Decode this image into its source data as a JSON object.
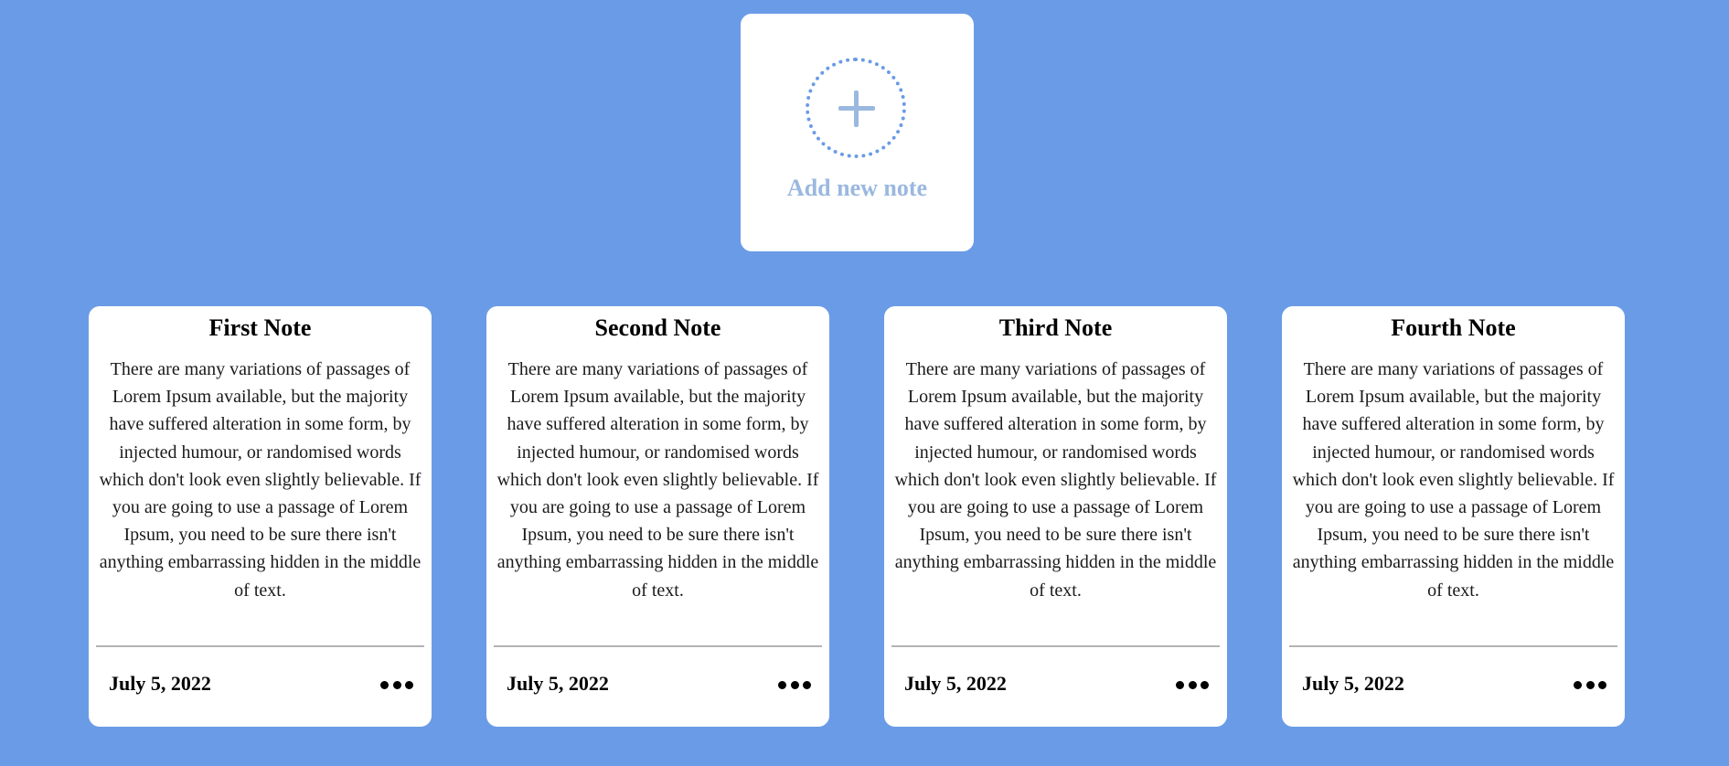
{
  "add_card": {
    "label": "Add new note",
    "icon": "plus-icon"
  },
  "notes": [
    {
      "title": "First Note",
      "body": "There are many variations of passages of Lorem Ipsum available, but the majority have suffered alteration in some form, by injected humour, or randomised words which don't look even slightly believable. If you are going to use a passage of Lorem Ipsum, you need to be sure there isn't anything embarrassing hidden in the middle of text.",
      "date": "July 5, 2022",
      "menu_icon": "more-horizontal-icon"
    },
    {
      "title": "Second Note",
      "body": "There are many variations of passages of Lorem Ipsum available, but the majority have suffered alteration in some form, by injected humour, or randomised words which don't look even slightly believable. If you are going to use a passage of Lorem Ipsum, you need to be sure there isn't anything embarrassing hidden in the middle of text.",
      "date": "July 5, 2022",
      "menu_icon": "more-horizontal-icon"
    },
    {
      "title": "Third Note",
      "body": "There are many variations of passages of Lorem Ipsum available, but the majority have suffered alteration in some form, by injected humour, or randomised words which don't look even slightly believable. If you are going to use a passage of Lorem Ipsum, you need to be sure there isn't anything embarrassing hidden in the middle of text.",
      "date": "July 5, 2022",
      "menu_icon": "more-horizontal-icon"
    },
    {
      "title": "Fourth Note",
      "body": "There are many variations of passages of Lorem Ipsum available, but the majority have suffered alteration in some form, by injected humour, or randomised words which don't look even slightly believable. If you are going to use a passage of Lorem Ipsum, you need to be sure there isn't anything embarrassing hidden in the middle of text.",
      "date": "July 5, 2022",
      "menu_icon": "more-horizontal-icon"
    }
  ],
  "colors": {
    "background": "#6a9be6",
    "card": "#ffffff",
    "accent": "#6a9be6",
    "muted_accent": "#9ab8e0",
    "divider": "#b3b3b3"
  }
}
